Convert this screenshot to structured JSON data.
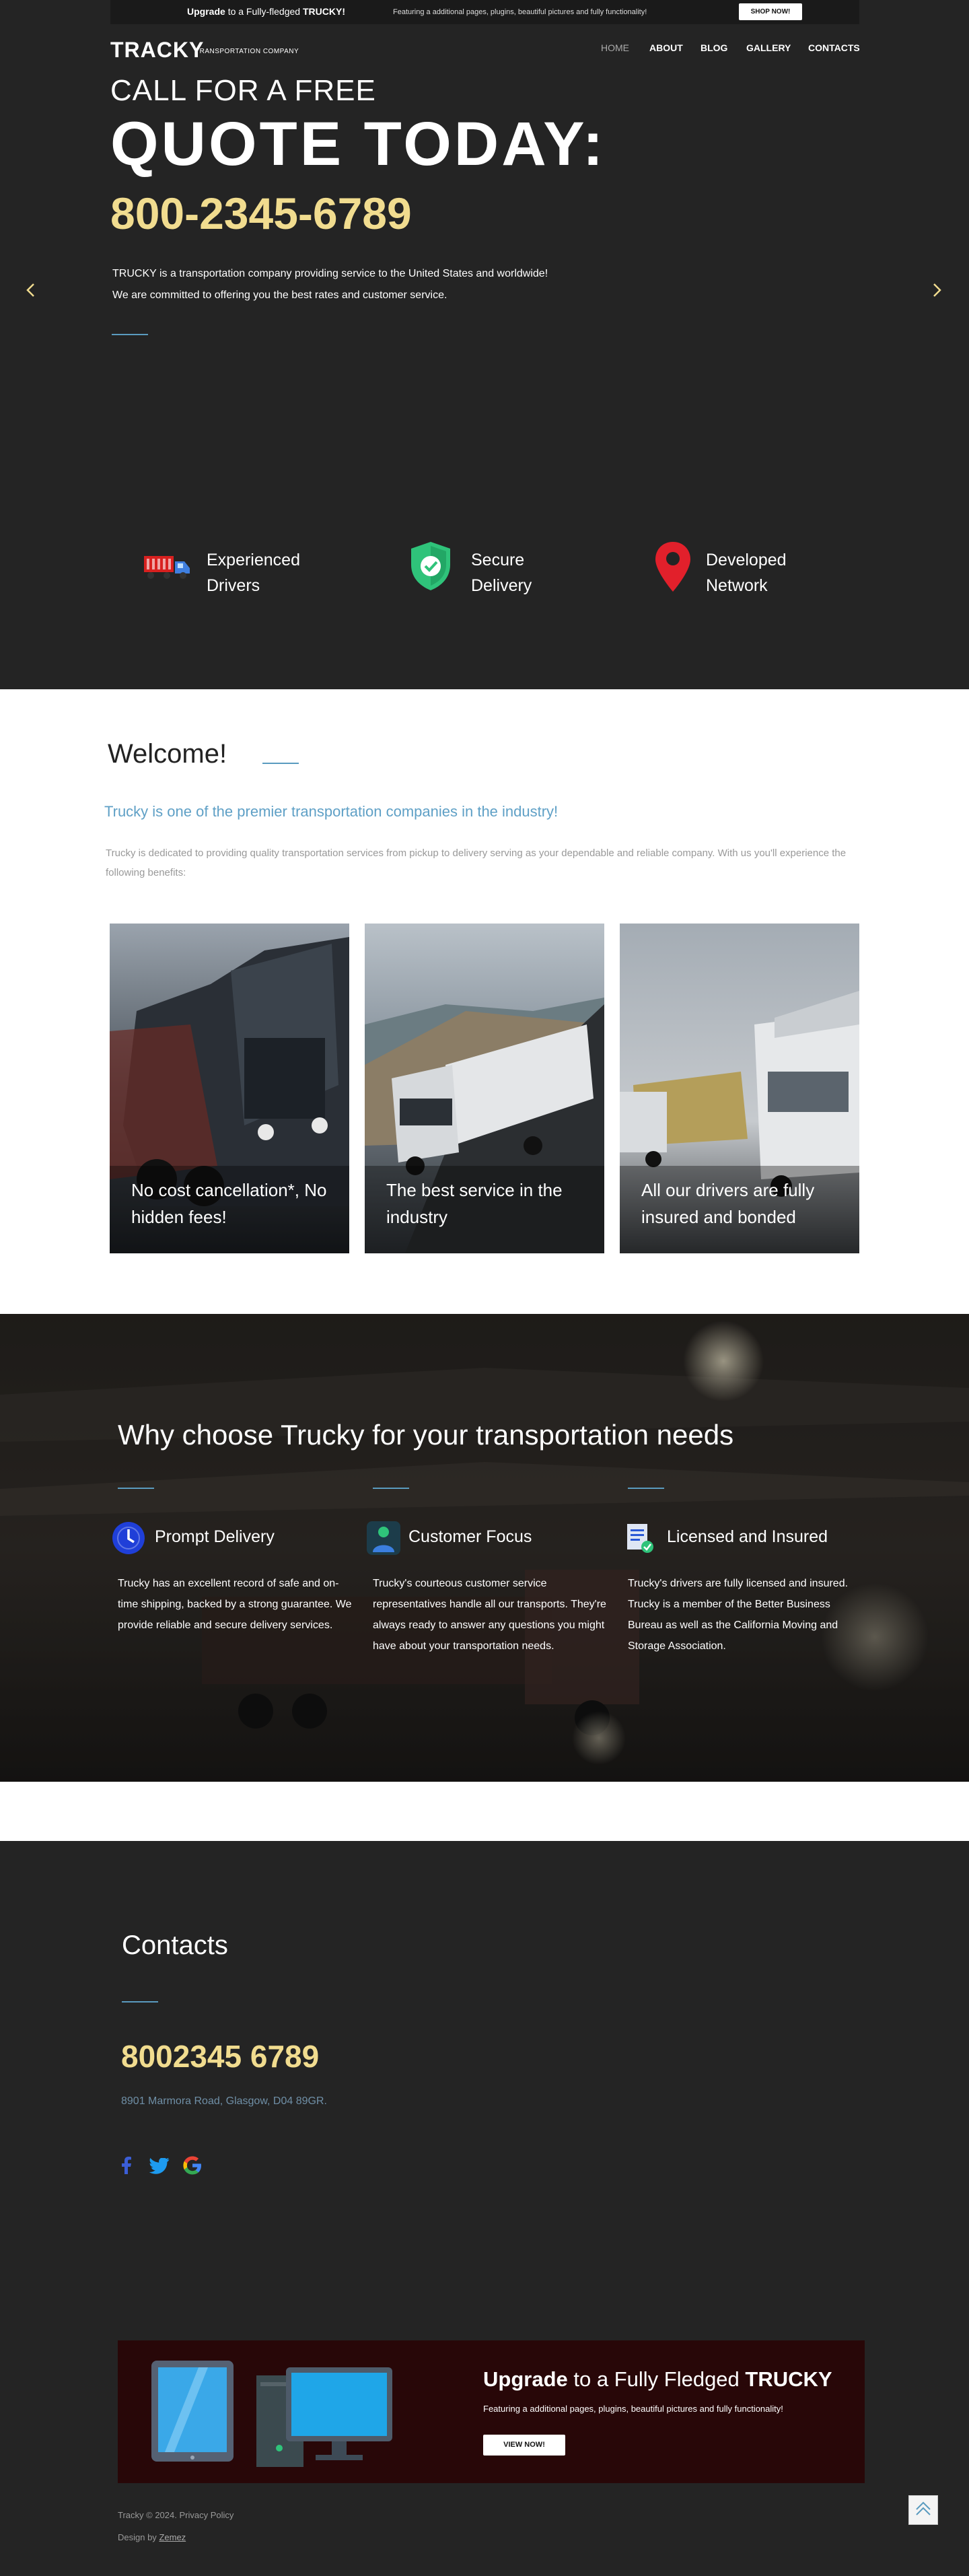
{
  "banner": {
    "upgrade_bold": "Upgrade",
    "upgrade_rest": "to a Fully-fledged",
    "brand": "TRUCKY!",
    "features": "Featuring a additional pages, plugins, beautiful pictures and fully functionality!",
    "shop_label": "SHOP NOW!"
  },
  "header": {
    "logo": "TRACKY",
    "logo_sub": "TRANSPORTATION COMPANY",
    "nav": [
      "HOME",
      "ABOUT",
      "BLOG",
      "GALLERY",
      "CONTACTS"
    ]
  },
  "hero": {
    "call": "CALL FOR A FREE",
    "quote": "QUOTE TODAY:",
    "phone": "800-2345-6789",
    "text1": "TRUCKY is a transportation company providing service to the United States and worldwide!",
    "text2": "We are committed to offering you the best rates and customer service."
  },
  "features": [
    {
      "line1": "Experienced",
      "line2": "Drivers",
      "icon": "truck-icon"
    },
    {
      "line1": "Secure",
      "line2": "Delivery",
      "icon": "shield-check-icon"
    },
    {
      "line1": "Developed",
      "line2": "Network",
      "icon": "map-pin-icon"
    }
  ],
  "welcome": {
    "title": "Welcome!",
    "subtitle": "Trucky is one of the premier transportation companies in the industry!",
    "text": "Trucky is dedicated to providing quality transportation services from pickup to delivery serving as your dependable and reliable company. With us you'll experience the following benefits:"
  },
  "cards": [
    {
      "caption": "No cost cancellation*, No hidden fees!"
    },
    {
      "caption": "The best service in the industry"
    },
    {
      "caption": "All our drivers are fully insured and bonded"
    }
  ],
  "why": {
    "title": "Why choose Trucky for your transportation needs",
    "items": [
      {
        "title": "Prompt Delivery",
        "text": "Trucky has an excellent record of safe and on-time shipping, backed by a strong guarantee. We provide reliable and secure delivery services.",
        "icon": "clock-icon"
      },
      {
        "title": "Customer Focus",
        "text": "Trucky's courteous customer service representatives handle all our transports. They're always ready to answer any questions you might have about your transportation needs.",
        "icon": "person-icon"
      },
      {
        "title": "Licensed and Insured",
        "text": "Trucky's drivers are fully licensed and insured. Trucky is a member of the Better Business Bureau as well as the California Moving and Storage Association.",
        "icon": "document-icon"
      }
    ]
  },
  "contacts": {
    "title": "Contacts",
    "phone": "8002345 6789",
    "address": "8901 Marmora Road, Glasgow, D04 89GR.",
    "social": [
      "facebook-icon",
      "twitter-icon",
      "google-icon"
    ]
  },
  "promo": {
    "heading_bold": "Upgrade",
    "heading_rest": "to a Fully Fledged",
    "brand": "TRUCKY",
    "sub": "Featuring a additional pages, plugins, beautiful pictures and fully functionality!",
    "button": "VIEW NOW!"
  },
  "footer": {
    "copyright": "Tracky © 2024.",
    "privacy": "Privacy Policy",
    "design_by": "Design by",
    "designer": "Zemez"
  },
  "colors": {
    "dark": "#242424",
    "gold": "#f1dc8f",
    "accent_blue": "#5a9bbf",
    "promo_bg": "#280708"
  }
}
